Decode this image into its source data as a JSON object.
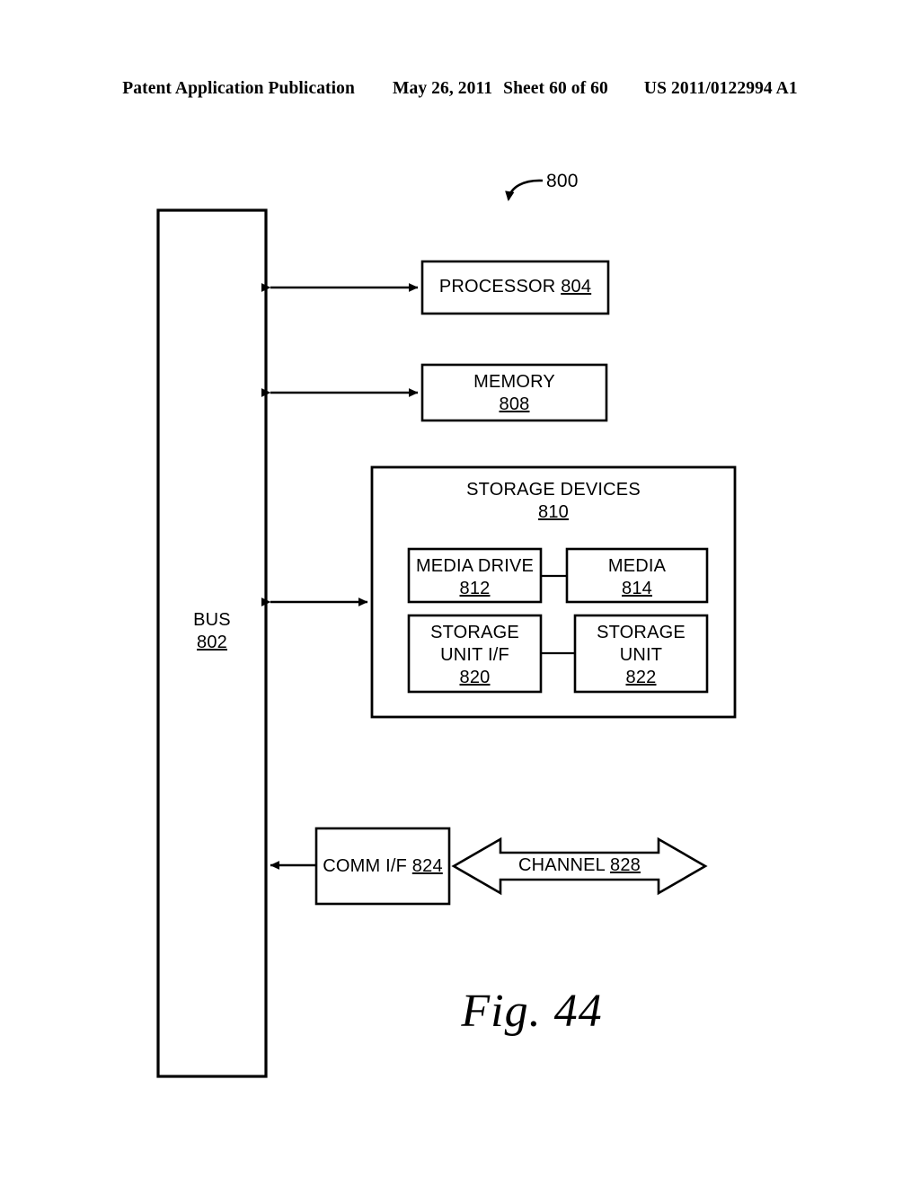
{
  "header": {
    "publication": "Patent Application Publication",
    "date": "May 26, 2011",
    "sheet": "Sheet 60 of 60",
    "patent_number": "US 2011/0122994 A1"
  },
  "figure": {
    "caption": "Fig. 44",
    "system_reference": "800"
  },
  "diagram": {
    "bus": {
      "label": "BUS",
      "number": "802"
    },
    "processor": {
      "label": "PROCESSOR",
      "number": "804"
    },
    "memory": {
      "label": "MEMORY",
      "number": "808"
    },
    "storage_devices": {
      "label": "STORAGE DEVICES",
      "number": "810",
      "items": [
        {
          "line1": "MEDIA DRIVE",
          "line2": "",
          "number": "812"
        },
        {
          "line1": "MEDIA",
          "line2": "",
          "number": "814"
        },
        {
          "line1": "STORAGE",
          "line2": "UNIT I/F",
          "number": "820"
        },
        {
          "line1": "STORAGE",
          "line2": "UNIT",
          "number": "822"
        }
      ]
    },
    "comm_if": {
      "label": "COMM I/F",
      "number": "824"
    },
    "channel": {
      "label": "CHANNEL",
      "number": "828"
    }
  },
  "colors": {
    "ink": "#000000",
    "paper": "#ffffff"
  }
}
